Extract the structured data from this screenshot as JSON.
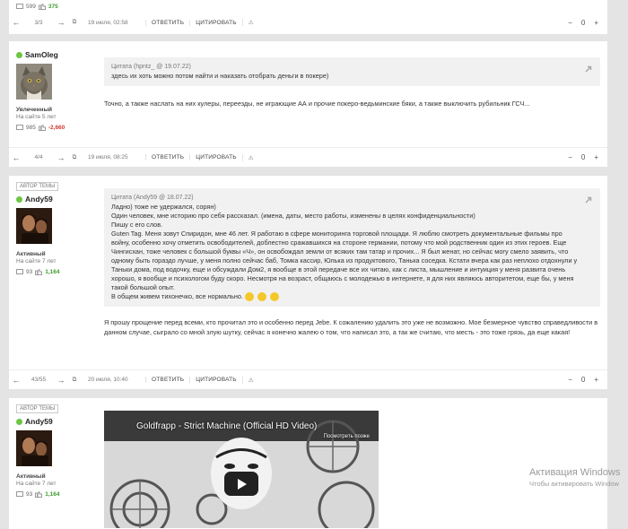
{
  "post0": {
    "stats": {
      "comments": "599",
      "rating": "375"
    },
    "footer": {
      "counter": "3/3",
      "date": "19 июля, 02:58",
      "reply": "ОТВЕТИТЬ",
      "quote": "ЦИТИРОВАТЬ",
      "score": "0"
    }
  },
  "post1": {
    "user": "SamOleg",
    "rank": "Увлеченный",
    "since": "На сайте 5 лет",
    "stats": {
      "comments": "985",
      "rating": "-2,660"
    },
    "quote_head": "Цитата (hpntz_ @ 19.07.22)",
    "quote_body": "здесь их хоть можно потом найти и наказать  отобрать деньги в покере)",
    "text": "Точно, а также наслать на них  кулеры, переезды, не играющие АА и прочие покеро-ведьминские бяки, а также выключить рубильник ГСЧ...",
    "footer": {
      "counter": "4/4",
      "date": "19 июля, 08:25",
      "reply": "ОТВЕТИТЬ",
      "quote": "ЦИТИРОВАТЬ",
      "score": "0"
    }
  },
  "post2": {
    "badge": "АВТОР ТЕМЫ",
    "user": "Andy59",
    "rank": "Активный",
    "since": "На сайте 7 лет",
    "stats": {
      "comments": "93",
      "rating": "1,164"
    },
    "quote_head": "Цитата (Andy59 @ 18.07.22)",
    "quote_body": "Ладно) тоже не удержался, сорян)\nОдин человек, мне историю про себя рассказал. (имена, даты, место работы, изменены в целях конфиденциальности)\nПишу с его слов.\n Guten Tag. Меня зовут Спиридон, мне 46 лет. Я работаю в сфере мониторинга торговой площади. Я люблю смотреть документальные фильмы про войну, особенно хочу отметить освободителей, доблестно сражавшихся на стороне германии, потому что мой родственник один из этих героев. Еще Чингисхан, тоже человек с большой буквы «Ч», он освобождал земли от всяких там татар и прочих... Я был женат, но сейчас могу смело заявить, что одному быть гораздо лучше, у меня полно сейчас баб, Томка кассир, Юлька из продуктового, Танька соседка. Кстати вчера как раз неплохо отдохнули у Таньки дома, под водочку, еще и обсуждали Дом2, я вообще в этой передаче все их читаю, как с листа, мышление и интуиция у меня развита очень хорошо, я вообще и психологом буду скоро. Несмотря на возраст, общаюсь с молодежью в интернете, я для них являюсь авторитетом, еще бы, у меня такой большой опыт.\nВ общем живем тихонечко, все нормально.",
    "text": "Я прошу прощение перед всеми, кто прочитал это и особенно перед Jebe. К сожалению удалить это уже не возможно. Мое безмерное чувство справедливости в данном случае, сыграло со мной злую шутку, сейчас я конечно жалею о том, что написал это, а так же считаю, что месть - это тоже грязь, да еще какая!",
    "footer": {
      "counter": "43/55",
      "date": "20 июля, 10:40",
      "reply": "ОТВЕТИТЬ",
      "quote": "ЦИТИРОВАТЬ",
      "score": "0"
    }
  },
  "post3": {
    "badge": "АВТОР ТЕМЫ",
    "user": "Andy59",
    "rank": "Активный",
    "since": "На сайте 7 лет",
    "stats": {
      "comments": "93",
      "rating": "1,164"
    },
    "video_title": "Goldfrapp - Strict Machine (Official HD Video)",
    "video_later": "Посмотреть позже"
  },
  "watermark": {
    "title": "Активация Windows",
    "subtitle": "Чтобы активировать Window"
  },
  "colors": {
    "online": "#6cc644",
    "positive": "#3c9a2a",
    "negative": "#d23a2a"
  }
}
